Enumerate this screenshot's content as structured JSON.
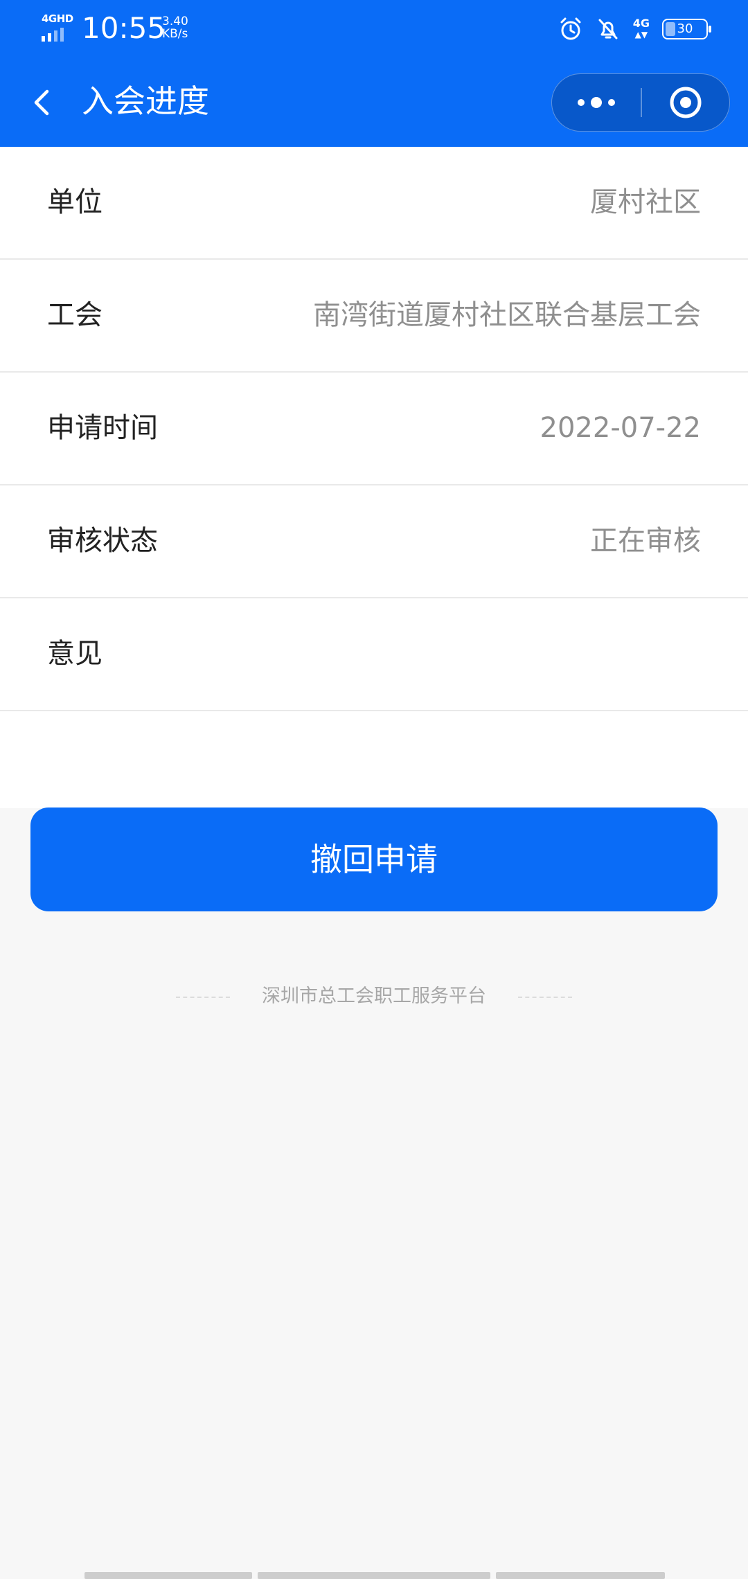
{
  "status_bar": {
    "network": "4GHD",
    "time": "10:55",
    "speed_value": "3.40",
    "speed_unit": "KB/s",
    "network_right": "4G",
    "battery": "30"
  },
  "nav": {
    "title": "入会进度"
  },
  "details": [
    {
      "label": "单位",
      "value": "厦村社区"
    },
    {
      "label": "工会",
      "value": "南湾街道厦村社区联合基层工会"
    },
    {
      "label": "申请时间",
      "value": "2022-07-22"
    },
    {
      "label": "审核状态",
      "value": "正在审核"
    },
    {
      "label": "意见",
      "value": ""
    }
  ],
  "action": {
    "withdraw_label": "撤回申请"
  },
  "footer": {
    "text": "深圳市总工会职工服务平台"
  },
  "colors": {
    "primary": "#0a6cf7",
    "background": "#f7f7f7"
  }
}
